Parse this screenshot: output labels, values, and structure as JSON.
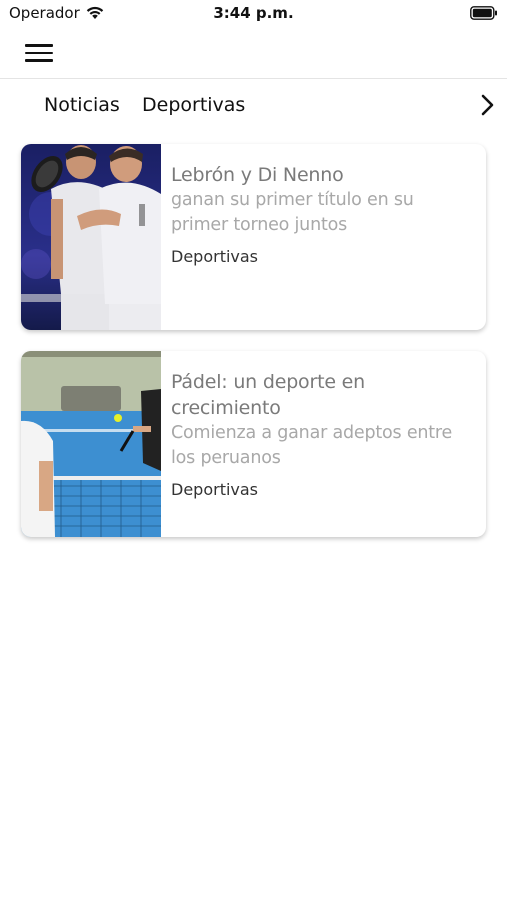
{
  "status_bar": {
    "carrier": "Operador",
    "time": "3:44 p.m.",
    "icons": [
      "wifi-icon",
      "battery-icon"
    ]
  },
  "header": {
    "menu_icon": "hamburger-menu-icon"
  },
  "tabs": {
    "items": [
      {
        "label": "Noticias"
      },
      {
        "label": "Deportivas"
      }
    ],
    "next_icon": "chevron-right-icon"
  },
  "articles": [
    {
      "title": "Lebrón y Di Nenno",
      "subtitle": "ganan su primer título en su primer torneo juntos",
      "category": "Deportivas",
      "image": "padel-players-celebrating-photo"
    },
    {
      "title": "Pádel: un deporte en crecimiento",
      "subtitle": "Comienza a ganar adeptos entre los peruanos",
      "category": "Deportivas",
      "image": "padel-court-photo"
    }
  ],
  "colors": {
    "title": "#7a7a7a",
    "subtitle": "#a8a8a8",
    "category": "#333333",
    "divider": "#e4e4e4"
  }
}
